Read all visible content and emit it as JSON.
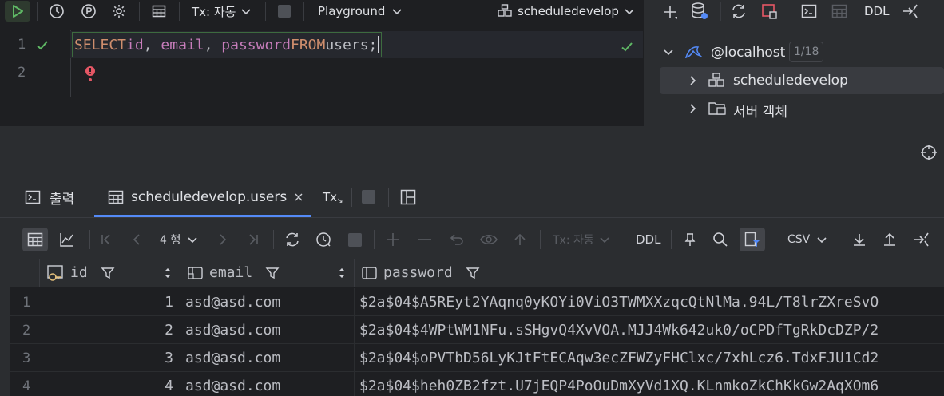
{
  "toolbar": {
    "tx_mode": "Tx: 자동",
    "playground": "Playground",
    "schema": "scheduledevelop",
    "ddl": "DDL"
  },
  "editor": {
    "line1": "1",
    "line2": "2",
    "sql": {
      "select": "SELECT",
      "id": "id",
      "comma1": ", ",
      "email": "email",
      "comma2": ", ",
      "password": "password",
      "from": "FROM",
      "table": "users",
      "semi": ";"
    }
  },
  "db_tree": {
    "host": "@localhost",
    "host_count": "1/18",
    "items": [
      {
        "label": "scheduledevelop"
      },
      {
        "label": "서버 객체"
      }
    ]
  },
  "results": {
    "tabs": [
      {
        "label": "출력"
      },
      {
        "label": "scheduledevelop.users"
      }
    ],
    "tx_short": "Tx",
    "grid_toolbar": {
      "rows": "4 행",
      "tx_mode": "Tx: 자동",
      "ddl": "DDL",
      "export_format": "CSV"
    },
    "columns": [
      {
        "name": "id"
      },
      {
        "name": "email"
      },
      {
        "name": "password"
      }
    ],
    "rows": [
      {
        "n": "1",
        "id": "1",
        "email": "asd@asd.com",
        "password": "$2a$04$A5REyt2YAqnq0yKOYi0ViO3TWMXXzqcQtNlMa.94L/T8lrZXreSvO"
      },
      {
        "n": "2",
        "id": "2",
        "email": "asd@asd.com",
        "password": "$2a$04$4WPtWM1NFu.sSHgvQ4XvVOA.MJJ4Wk642uk0/oCPDfTgRkDcDZP/2"
      },
      {
        "n": "3",
        "id": "3",
        "email": "asd@asd.com",
        "password": "$2a$04$oPVTbD56LyKJtFtECAqw3ecZFWZyFHClxc/7xhLcz6.TdxFJU1Cd2"
      },
      {
        "n": "4",
        "id": "4",
        "email": "asd@asd.com",
        "password": "$2a$04$heh0ZB2fzt.U7jEQP4PoOuDmXyVd1XQ.KLnmkoZkChKkGw2AqXOm6"
      }
    ]
  },
  "colors": {
    "accent_green": "#5fb865",
    "error_red": "#e55765",
    "keyword": "#cf8e6d",
    "column": "#c77dbb"
  }
}
